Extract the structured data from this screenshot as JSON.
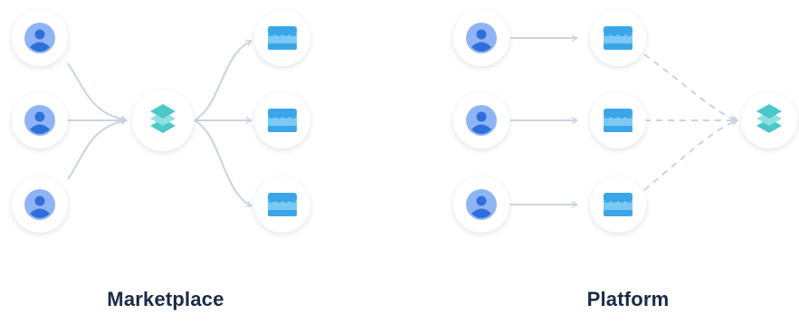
{
  "captions": {
    "marketplace": "Marketplace",
    "platform": "Platform"
  },
  "icons": {
    "user": "user-avatar-icon",
    "store": "storefront-icon",
    "hub": "layers-stack-icon"
  },
  "colors": {
    "user_bg": "#8fb4f6",
    "user_fg": "#2f6fd9",
    "store_main": "#7cc9f5",
    "store_dark": "#3aa6e8",
    "hub_main": "#8fe0e0",
    "hub_dark": "#4cc7c9",
    "edge": "#c9d3df",
    "caption": "#1a2b47"
  }
}
